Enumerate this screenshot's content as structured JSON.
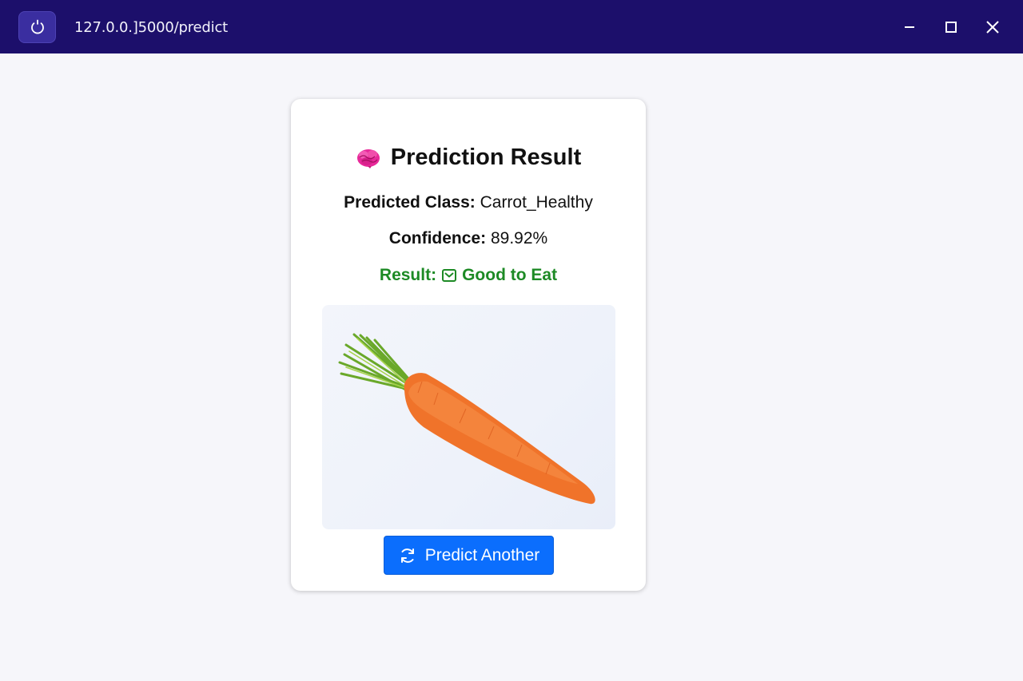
{
  "window": {
    "url": "127.0.0.]5000/predict"
  },
  "card": {
    "title": "Prediction Result",
    "predicted_class_label": "Predicted Class:",
    "predicted_class_value": "Carrot_Healthy",
    "confidence_label": "Confidence:",
    "confidence_value": "89.92%",
    "result_label": "Result:",
    "result_value": "Good to Eat",
    "button_label": "Predict Another"
  },
  "icons": {
    "title_icon": "brain-icon",
    "result_icon": "check-box-icon",
    "button_icon": "refresh-icon",
    "reload_icon": "reload-icon"
  },
  "colors": {
    "titlebar": "#1c0f6b",
    "result_green": "#1d8a25",
    "button_blue": "#0b6efd",
    "brain_pink": "#e8299a"
  }
}
